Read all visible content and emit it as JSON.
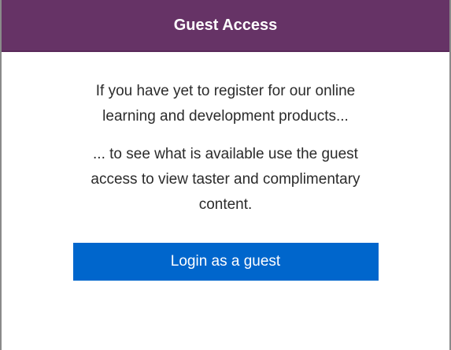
{
  "panel": {
    "title": "Guest Access",
    "paragraph1": "If you have yet to register for our online learning and development products...",
    "paragraph2": "... to see what is available use the guest access to view taster and complimentary content.",
    "button_label": "Login as a guest"
  },
  "colors": {
    "header_bg": "#663366",
    "button_bg": "#0066cc"
  }
}
